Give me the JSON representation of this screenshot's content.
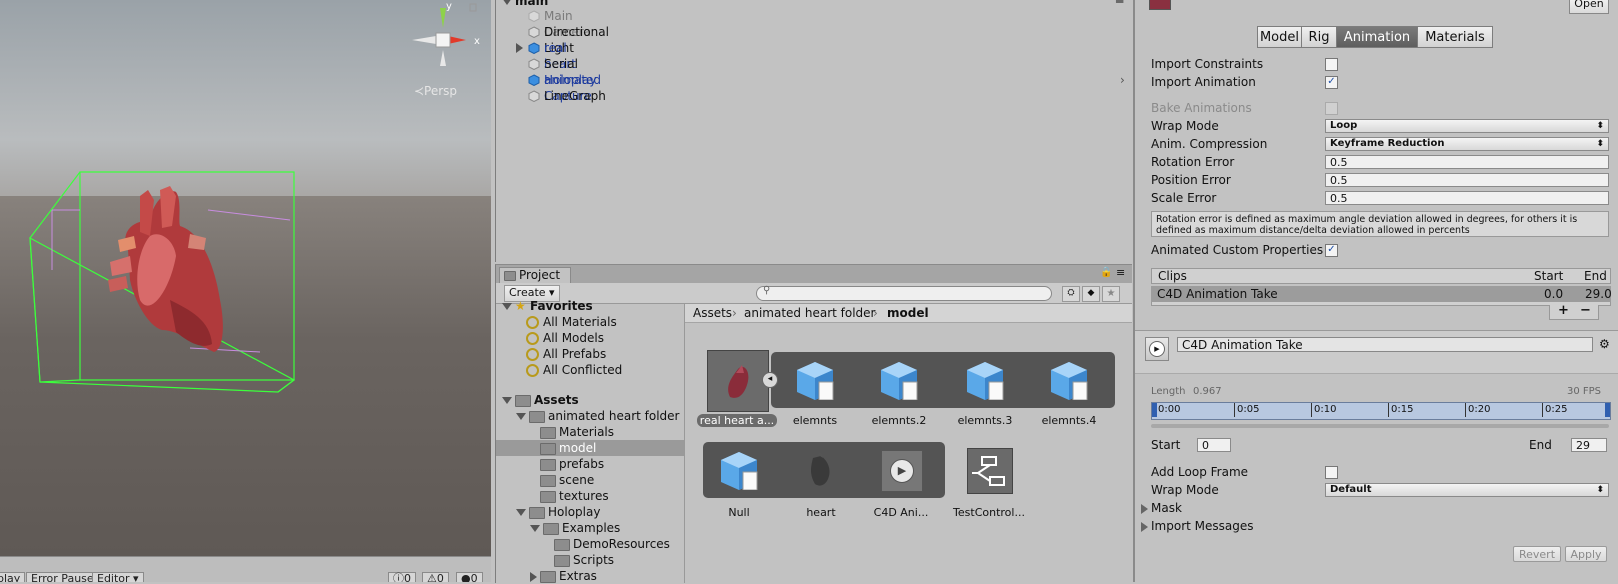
{
  "scene": {
    "persp_label": "≺Persp",
    "gizmo": {
      "x": "x",
      "y": "y"
    },
    "bottom_buttons": [
      "play",
      "Error Pause",
      "Editor ▾"
    ],
    "counters": [
      "0",
      "0",
      "0"
    ]
  },
  "hierarchy": {
    "scene_name": "main",
    "items": [
      {
        "label": "Main Camera",
        "style": "disabled"
      },
      {
        "label": "Directional Light",
        "style": "normal"
      },
      {
        "label": "real heart animated",
        "style": "prefab"
      },
      {
        "label": "Serial",
        "style": "normal"
      },
      {
        "label": "Holoplay Capture",
        "style": "prefab"
      },
      {
        "label": "LineGraph",
        "style": "normal"
      }
    ]
  },
  "project": {
    "tab_label": "Project",
    "create_label": "Create",
    "search_placeholder": "",
    "tree": {
      "favorites_label": "Favorites",
      "favorites": [
        "All Materials",
        "All Models",
        "All Prefabs",
        "All Conflicted"
      ],
      "assets_label": "Assets",
      "items": [
        {
          "label": "animated heart folder",
          "level": 1,
          "arrow": "down"
        },
        {
          "label": "Materials",
          "level": 2
        },
        {
          "label": "model",
          "level": 2,
          "selected": true
        },
        {
          "label": "prefabs",
          "level": 2
        },
        {
          "label": "scene",
          "level": 2
        },
        {
          "label": "textures",
          "level": 2
        },
        {
          "label": "Holoplay",
          "level": 1,
          "arrow": "down"
        },
        {
          "label": "Examples",
          "level": 2,
          "arrow": "down"
        },
        {
          "label": "DemoResources",
          "level": 3
        },
        {
          "label": "Scripts",
          "level": 3
        },
        {
          "label": "Extras",
          "level": 2,
          "arrow": "right"
        }
      ]
    },
    "breadcrumb": [
      "Assets",
      "animated heart folder",
      "model"
    ],
    "assets_row1": [
      "real heart a...",
      "elemnts",
      "elemnts.2",
      "elemnts.3",
      "elemnts.4"
    ],
    "assets_row2": [
      "Null",
      "heart",
      "C4D Ani...",
      "TestControl..."
    ]
  },
  "inspector": {
    "open_label": "Open",
    "tabs": [
      "Model",
      "Rig",
      "Animation",
      "Materials"
    ],
    "selected_tab": "Animation",
    "import_constraints_label": "Import Constraints",
    "import_constraints": false,
    "import_animation_label": "Import Animation",
    "import_animation": true,
    "bake_animations_label": "Bake Animations",
    "wrap_mode_label": "Wrap Mode",
    "wrap_mode_value": "Loop",
    "anim_compression_label": "Anim. Compression",
    "anim_compression_value": "Keyframe Reduction",
    "rotation_error_label": "Rotation Error",
    "rotation_error_value": "0.5",
    "position_error_label": "Position Error",
    "position_error_value": "0.5",
    "scale_error_label": "Scale Error",
    "scale_error_value": "0.5",
    "help_text": "Rotation error is defined as maximum angle deviation allowed in degrees, for others it is defined as maximum distance/delta deviation allowed in percents",
    "animated_custom_label": "Animated Custom Properties",
    "animated_custom": true,
    "clips": {
      "header_clips": "Clips",
      "header_start": "Start",
      "header_end": "End",
      "rows": [
        {
          "name": "C4D Animation Take",
          "start": "0.0",
          "end": "29.0"
        }
      ],
      "add": "+",
      "remove": "−"
    },
    "clip_name": "C4D Animation Take",
    "length_label": "Length",
    "length_value": "0.967",
    "fps_label": "30 FPS",
    "timeline_ticks": [
      "0:00",
      "0:05",
      "0:10",
      "0:15",
      "0:20",
      "0:25"
    ],
    "start_label": "Start",
    "start_value": "0",
    "end_label": "End",
    "end_value": "29",
    "add_loop_frame_label": "Add Loop Frame",
    "clip_wrap_mode_label": "Wrap Mode",
    "clip_wrap_mode_value": "Default",
    "mask_label": "Mask",
    "import_messages_label": "Import Messages",
    "revert_label": "Revert",
    "apply_label": "Apply"
  }
}
